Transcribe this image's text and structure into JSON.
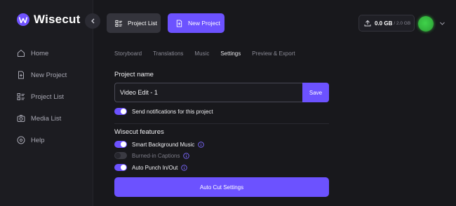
{
  "brand": {
    "name": "Wisecut",
    "accent": "#6c52ff"
  },
  "sidebar": {
    "items": [
      {
        "label": "Home",
        "icon": "home-icon"
      },
      {
        "label": "New Project",
        "icon": "file-plus-icon"
      },
      {
        "label": "Project List",
        "icon": "list-icon"
      },
      {
        "label": "Media List",
        "icon": "camera-icon"
      },
      {
        "label": "Help",
        "icon": "help-circle-icon"
      }
    ]
  },
  "header": {
    "project_list_label": "Project List",
    "new_project_label": "New Project",
    "storage": {
      "used": "0.0 GB",
      "total": "/ 2.0 GB"
    }
  },
  "tabs": [
    {
      "label": "Storyboard",
      "active": false
    },
    {
      "label": "Translations",
      "active": false
    },
    {
      "label": "Music",
      "active": false
    },
    {
      "label": "Settings",
      "active": true
    },
    {
      "label": "Preview & Export",
      "active": false
    }
  ],
  "settings": {
    "project_name_title": "Project name",
    "project_name_value": "Video Edit - 1",
    "save_label": "Save",
    "notify_label": "Send notifications for this project",
    "notify_on": true,
    "features_title": "Wisecut features",
    "features": [
      {
        "label": "Smart Background Music",
        "on": true,
        "info": true
      },
      {
        "label": "Burned-in Captions",
        "on": false,
        "info": true
      },
      {
        "label": "Auto Punch In/Out",
        "on": true,
        "info": true
      }
    ],
    "autocut_label": "Auto Cut Settings"
  }
}
